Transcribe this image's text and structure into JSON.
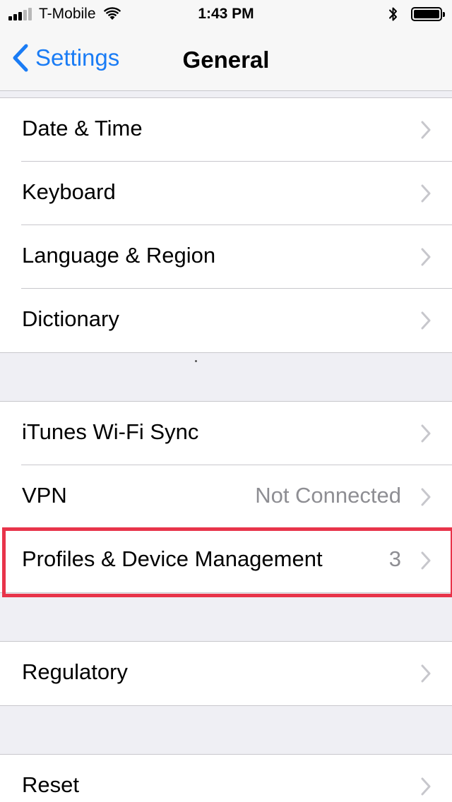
{
  "status_bar": {
    "carrier": "T-Mobile",
    "time": "1:43 PM",
    "signal_bars_filled": 3,
    "signal_bars_total": 5,
    "battery_level": 1.0,
    "icons": [
      "signal-icon",
      "wifi-icon",
      "bluetooth-icon",
      "battery-icon"
    ]
  },
  "nav": {
    "back_label": "Settings",
    "title": "General"
  },
  "groups": [
    {
      "rows": [
        {
          "label": "Date & Time",
          "value": ""
        },
        {
          "label": "Keyboard",
          "value": ""
        },
        {
          "label": "Language & Region",
          "value": ""
        },
        {
          "label": "Dictionary",
          "value": ""
        }
      ]
    },
    {
      "rows": [
        {
          "label": "iTunes Wi-Fi Sync",
          "value": ""
        },
        {
          "label": "VPN",
          "value": "Not Connected"
        },
        {
          "label": "Profiles & Device Management",
          "value": "3"
        }
      ]
    },
    {
      "rows": [
        {
          "label": "Regulatory",
          "value": ""
        }
      ]
    },
    {
      "rows": [
        {
          "label": "Reset",
          "value": ""
        }
      ]
    }
  ],
  "colors": {
    "accent": "#1a7cf5",
    "highlight": "#e8344a",
    "background": "#efeff4",
    "secondary_text": "#8e8e93"
  }
}
